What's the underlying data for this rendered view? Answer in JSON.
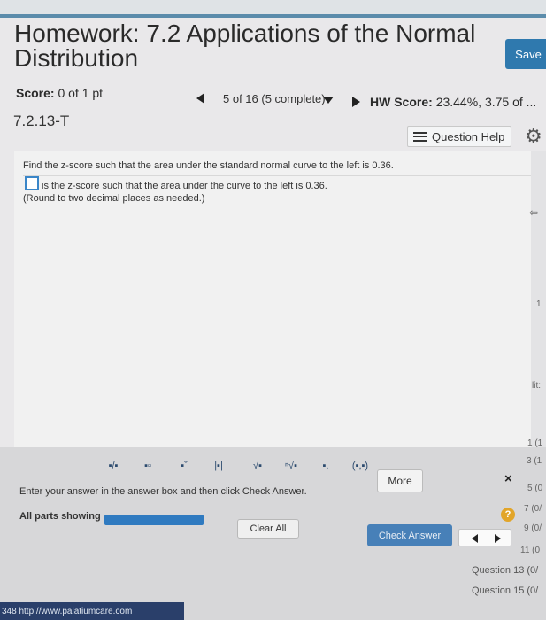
{
  "header": {
    "title": "Homework: 7.2 Applications of the Normal Distribution",
    "save_label": "Save"
  },
  "score": {
    "label": "Score:",
    "value": "0 of 1 pt",
    "position": "5 of 16 (5 complete)",
    "hw_label": "HW Score:",
    "hw_value": "23.44%, 3.75 of ..."
  },
  "question": {
    "id": "7.2.13-T",
    "help_label": "Question Help",
    "text": "Find the z-score such that the area under the standard normal curve to the left is 0.36.",
    "answer_suffix": "is the z-score such that the area under the curve to the left is 0.36.",
    "round_note": "(Round to two decimal places as needed.)"
  },
  "side_fragments": [
    "1",
    "lit:",
    "1 (1",
    "3 (1",
    "5 (0",
    "7 (0/",
    "9 (0/",
    "11 (0"
  ],
  "toolbar": {
    "buttons": [
      "▪/▪",
      "▪▫",
      "▪ˇ",
      "|▪|",
      "√▪",
      "ⁿ√▪",
      "▪.",
      "(▪,▪)"
    ],
    "more_label": "More",
    "close_label": "×"
  },
  "footer": {
    "hint": "Enter your answer in the answer box and then click Check Answer.",
    "parts_label": "All parts showing",
    "progress": 1.0,
    "clear_label": "Clear All",
    "check_label": "Check Answer",
    "help_label": "?",
    "question_links": [
      "Question 13 (0/",
      "Question 15 (0/"
    ],
    "status_url": "348 http://www.palatiumcare.com"
  },
  "colors": {
    "accent": "#2f79ae",
    "check_button": "#4780b8",
    "status_bar": "#2a3f6a",
    "help": "#e2a529"
  }
}
